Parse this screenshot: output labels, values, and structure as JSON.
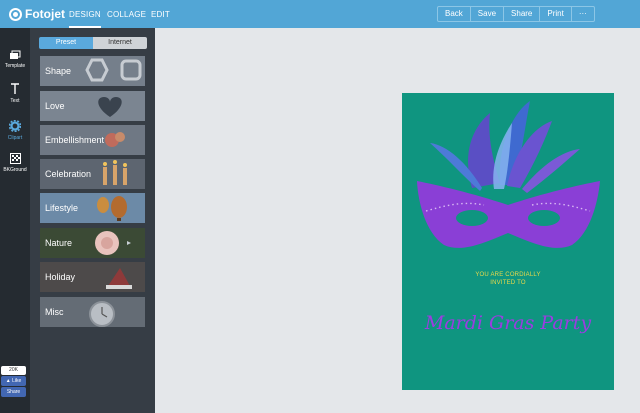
{
  "app": {
    "name": "Fotojet"
  },
  "nav": {
    "design": "DESIGN",
    "collage": "COLLAGE",
    "edit": "EDIT"
  },
  "actions": {
    "back": "Back",
    "save": "Save",
    "share": "Share",
    "print": "Print",
    "more": "···"
  },
  "rail": [
    {
      "label": "Template",
      "icon": "template-icon"
    },
    {
      "label": "Text",
      "icon": "text-icon"
    },
    {
      "label": "Clipart",
      "icon": "gear-icon",
      "active": true
    },
    {
      "label": "BKGround",
      "icon": "background-icon"
    }
  ],
  "segment": {
    "preset": "Preset",
    "internet": "Internet",
    "selected": "Preset"
  },
  "categories": [
    "Shape",
    "Love",
    "Embellishment",
    "Celebration",
    "Lifestyle",
    "Nature",
    "Holiday",
    "Misc"
  ],
  "facebook": {
    "count": "20K",
    "like": "Like",
    "share": "Share"
  },
  "poster": {
    "line1": "YOU ARE CORDIALLY",
    "line2": "INVITED TO",
    "title": "Mardi Gras Party"
  },
  "colors": {
    "topbar": "#52a6d6",
    "poster_bg": "#0f9580",
    "mask": "#8a3fd6",
    "title": "#9a3de0",
    "invite": "#e8d94a"
  }
}
